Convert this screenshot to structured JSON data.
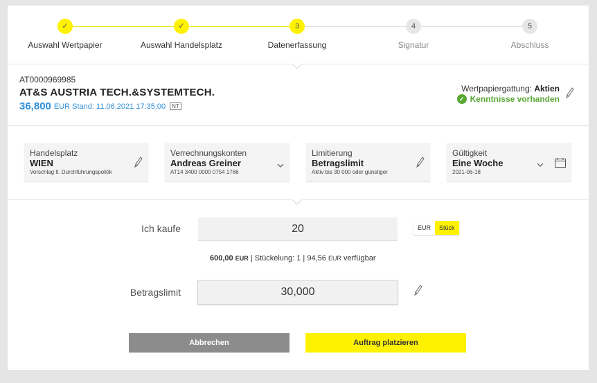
{
  "stepper": {
    "steps": [
      {
        "symbol": "✓",
        "label": "Auswahl Wertpapier",
        "state": "done"
      },
      {
        "symbol": "✓",
        "label": "Auswahl Handelsplatz",
        "state": "done"
      },
      {
        "symbol": "3",
        "label": "Datenerfassung",
        "state": "current"
      },
      {
        "symbol": "4",
        "label": "Signatur",
        "state": "todo"
      },
      {
        "symbol": "5",
        "label": "Abschluss",
        "state": "todo"
      }
    ]
  },
  "security": {
    "isin": "AT0000969985",
    "name": "AT&S AUSTRIA TECH.&SYSTEMTECH.",
    "price": "36,800",
    "price_meta": "EUR Stand: 11.06.2021 17:35:00",
    "badge": "NT",
    "gattung_label": "Wertpapiergattung:",
    "gattung_value": "Aktien",
    "knowledge": "Kenntnisse vorhanden"
  },
  "params": {
    "handelsplatz": {
      "title": "Handelsplatz",
      "value": "WIEN",
      "sub": "Vorschlag lt. Durchführungspolitik"
    },
    "konten": {
      "title": "Verrechnungskonten",
      "value": "Andreas Greiner",
      "sub": "AT14 3400 0000 0754 1766"
    },
    "limitierung": {
      "title": "Limitierung",
      "value": "Betragslimit",
      "sub": "Aktiv bis 30 000 oder günstiger"
    },
    "gueltigkeit": {
      "title": "Gültigkeit",
      "value": "Eine Woche",
      "sub": "2021-06-18"
    }
  },
  "order": {
    "buy_label": "Ich kaufe",
    "quantity": "20",
    "toggle": {
      "eur": "EUR",
      "stueck": "Stück",
      "selected": "Stück"
    },
    "info_amount": "600,00",
    "info_cur1": "EUR",
    "info_mid": "| Stückelung: 1 |",
    "info_avail": "94,56",
    "info_cur2": "EUR",
    "info_tail": "verfügbar",
    "limit_label": "Betragslimit",
    "limit_value": "30,000"
  },
  "buttons": {
    "cancel": "Abbrechen",
    "place": "Auftrag platzieren"
  },
  "colors": {
    "accent_yellow": "#fff200",
    "price_blue": "#2f8fd8",
    "success_green": "#5aa835",
    "cancel_gray": "#8c8c8c"
  },
  "icons": {
    "edit": "pencil-icon",
    "dropdown": "chevron-down-icon",
    "calendar": "calendar-icon",
    "check": "check-circle-icon"
  }
}
